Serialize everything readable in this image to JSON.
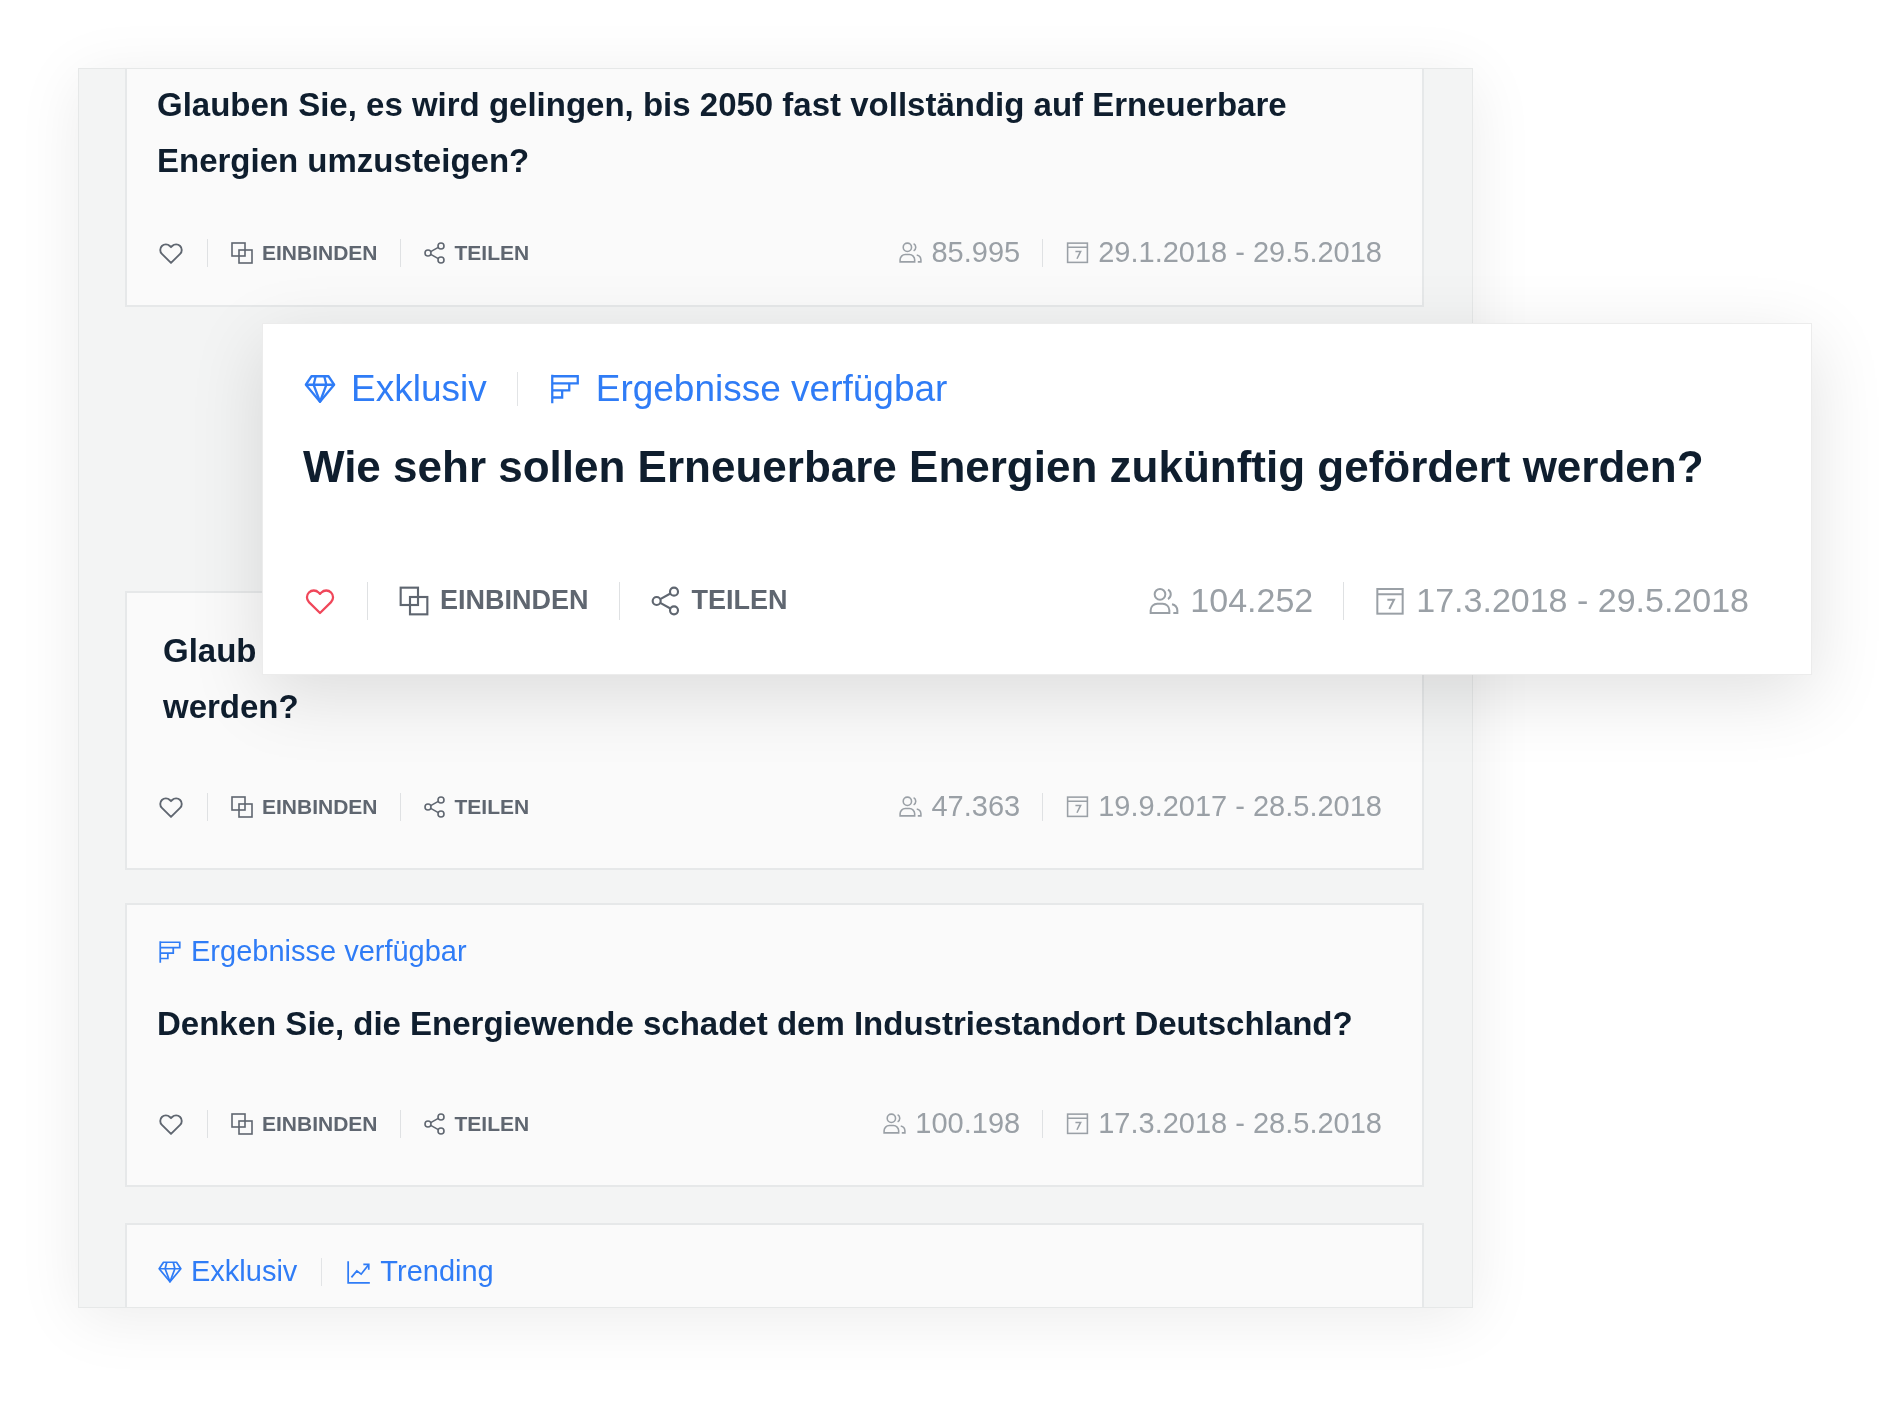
{
  "cards": [
    {
      "title": "Glauben Sie, es wird gelingen, bis 2050 fast vollständig auf Erneuerbare Energien umzusteigen?",
      "liked": false,
      "actions": [
        {
          "kind": "embed",
          "label": "EINBINDEN"
        },
        {
          "kind": "share",
          "label": "TEILEN"
        }
      ],
      "participants": "85.995",
      "period": "29.1.2018 - 29.5.2018"
    },
    {
      "title": "Glaub\nwerden?",
      "liked": false,
      "actions": [
        {
          "kind": "embed",
          "label": "EINBINDEN"
        },
        {
          "kind": "share",
          "label": "TEILEN"
        }
      ],
      "participants": "47.363",
      "period": "19.9.2017 - 28.5.2018"
    },
    {
      "tags": [
        {
          "kind": "results",
          "label": "Ergebnisse verfügbar"
        }
      ],
      "title": "Denken Sie, die Energiewende schadet dem Industriestandort Deutschland?",
      "liked": false,
      "actions": [
        {
          "kind": "embed",
          "label": "EINBINDEN"
        },
        {
          "kind": "share",
          "label": "TEILEN"
        }
      ],
      "participants": "100.198",
      "period": "17.3.2018 - 28.5.2018"
    },
    {
      "tags": [
        {
          "kind": "exclusive",
          "label": "Exklusiv"
        },
        {
          "kind": "trending",
          "label": "Trending"
        }
      ]
    }
  ],
  "featured": {
    "tags": [
      {
        "kind": "exclusive",
        "label": "Exklusiv"
      },
      {
        "kind": "results",
        "label": "Ergebnisse verfügbar"
      }
    ],
    "title": "Wie sehr sollen Erneuerbare Energien zukünftig gefördert werden?",
    "liked": true,
    "actions": [
      {
        "kind": "embed",
        "label": "EINBINDEN"
      },
      {
        "kind": "share",
        "label": "TEILEN"
      }
    ],
    "participants": "104.252",
    "period": "17.3.2018 - 29.5.2018"
  }
}
